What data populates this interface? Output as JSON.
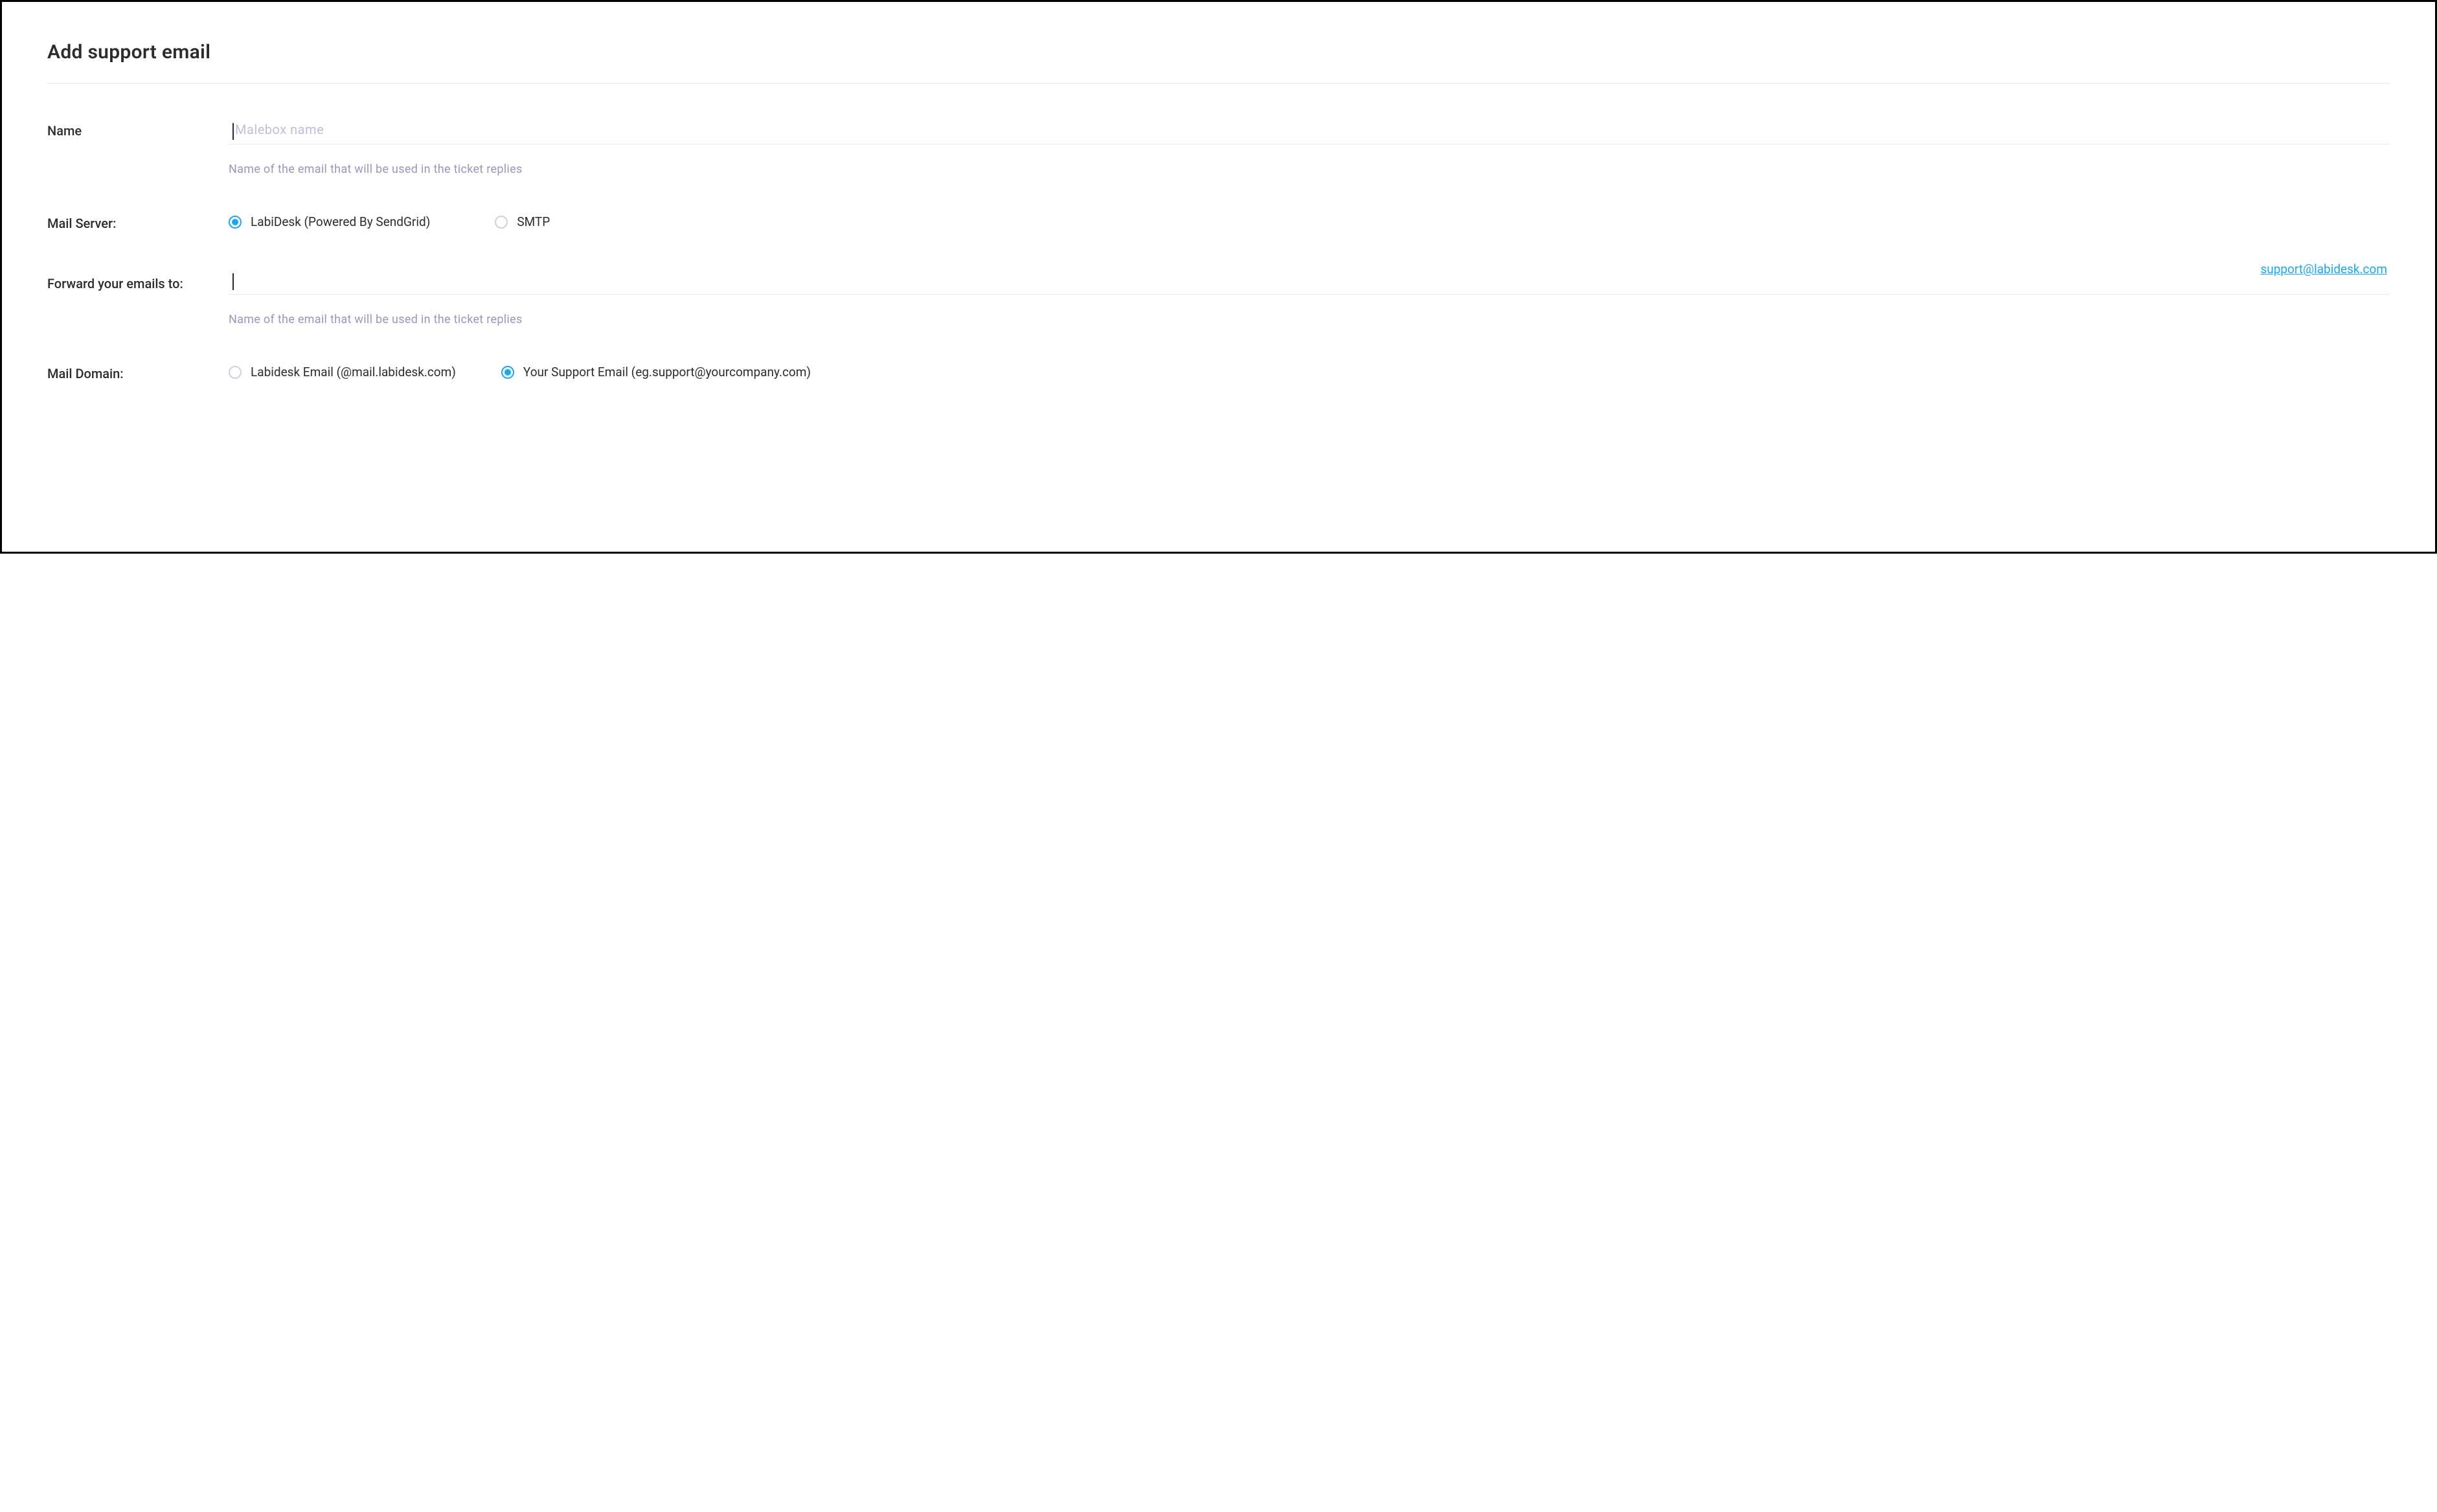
{
  "page": {
    "title": "Add support email"
  },
  "form": {
    "name": {
      "label": "Name",
      "placeholder": "Malebox name",
      "value": "",
      "help": "Name of the email that will be used in the ticket replies"
    },
    "mailServer": {
      "label": "Mail Server:",
      "options": [
        {
          "label": "LabiDesk (Powered By SendGrid)",
          "selected": true
        },
        {
          "label": "SMTP",
          "selected": false
        }
      ]
    },
    "forward": {
      "label": "Forward your emails to:",
      "value": "",
      "linkText": "support@labidesk.com",
      "help": "Name of the email that will be used in the ticket replies"
    },
    "mailDomain": {
      "label": "Mail Domain:",
      "options": [
        {
          "label": "Labidesk Email (@mail.labidesk.com)",
          "selected": false
        },
        {
          "label": "Your Support Email (eg.support@yourcompany.com)",
          "selected": true
        }
      ]
    }
  }
}
